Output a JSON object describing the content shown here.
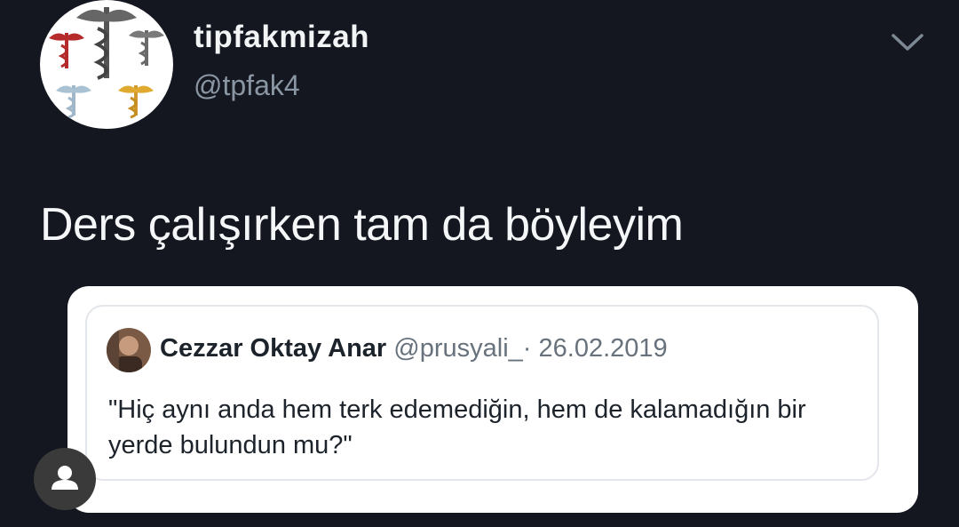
{
  "tweet": {
    "author": {
      "display_name": "tipfakmizah",
      "handle": "@tpfak4",
      "avatar_icon": "caduceus-logo"
    },
    "menu_icon": "chevron-down-icon",
    "text": "Ders çalışırken tam da böyleyim",
    "quoted": {
      "author_name": "Cezzar Oktay Anar",
      "handle": "@prusyali_",
      "separator": "·",
      "date": "26.02.2019",
      "text": "\"Hiç aynı anda hem terk edemediğin, hem de kalamadığın bir yerde bulundun mu?\""
    }
  },
  "overlay": {
    "profile_icon": "user-icon"
  },
  "colors": {
    "background": "#14171f",
    "text_primary": "#f4f6f8",
    "text_secondary": "#8a96a3",
    "quote_text": "#1c232b",
    "quote_meta": "#67727d"
  }
}
